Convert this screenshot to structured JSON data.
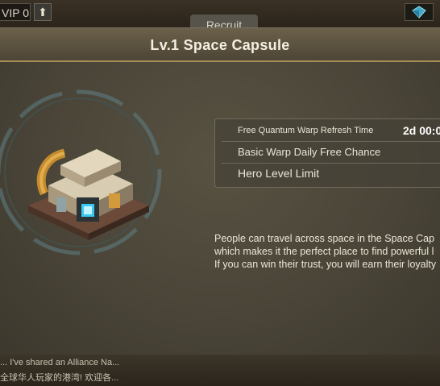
{
  "top_bar": {
    "vip_label": "VIP 0",
    "recruit_label": "Recruit",
    "upgrade_glyph": "⬆"
  },
  "panel": {
    "title": "Lv.1 Space Capsule",
    "info_rows": [
      {
        "label": "Free Quantum Warp Refresh Time",
        "value": "2d 00:0"
      },
      {
        "label": "Basic Warp Daily Free Chance",
        "value": ""
      },
      {
        "label": "Hero Level Limit",
        "value": ""
      }
    ],
    "description_lines": [
      "People can travel across space in the Space Cap",
      "which makes it the perfect place to find powerful l",
      "If you can win their trust, you will earn their loyalty"
    ]
  },
  "chat": {
    "lines": [
      "... I've shared an Alliance Na...",
      "全球华人玩家的港湾! 欢迎各..."
    ]
  },
  "colors": {
    "panel_bg": "#4a4538",
    "header_border": "#a88e56",
    "ring": "#5d7f86",
    "text": "#ece6d6"
  },
  "icons": {
    "upgrade": "arrow-up-icon",
    "gem": "gem-icon",
    "building": "space-capsule-building"
  }
}
